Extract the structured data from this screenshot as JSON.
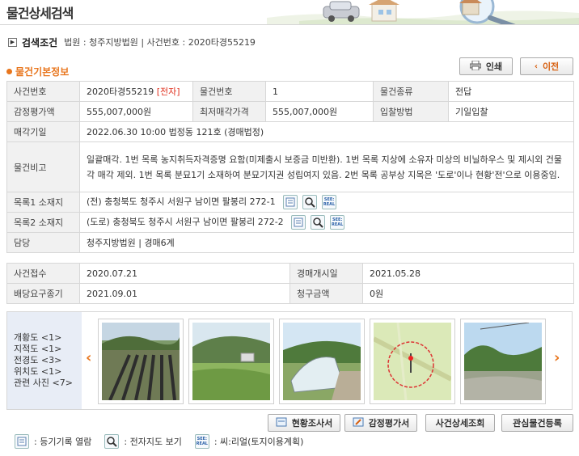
{
  "header": {
    "title": "물건상세검색"
  },
  "search_condition": {
    "title": "검색조건",
    "text": "법원 : 청주지방법원  |  사건번호 : 2020타경55219"
  },
  "section": {
    "title": "물건기본정보"
  },
  "actions": {
    "print": "인쇄",
    "back": "이전"
  },
  "basic": {
    "case_no_label": "사건번호",
    "case_no": "2020타경55219",
    "e_tag": "[전자]",
    "item_no_label": "물건번호",
    "item_no": "1",
    "item_type_label": "물건종류",
    "item_type": "전답",
    "appraisal_label": "감정평가액",
    "appraisal": "555,007,000원",
    "min_price_label": "최저매각가격",
    "min_price": "555,007,000원",
    "bid_method_label": "입찰방법",
    "bid_method": "기일입찰",
    "sale_date_label": "매각기일",
    "sale_date": "2022.06.30 10:00 법정동 121호 (경매법정)",
    "remark_label": "물건비고",
    "remark": "일괄매각. 1번 목록 농지취득자격증명 요함(미제출시 보증금 미반환). 1번 목록 지상에 소유자 미상의 비닐하우스 및 제시외 건물 각 매각 제외. 1번 목록 분묘1기 소재하여 분묘기지권 성립여지 있음. 2번 목록 공부상 지목은 '도로'이나 현황'전'으로 이용중임.",
    "loc1_label": "목록1 소재지",
    "loc1": "(전) 충청북도 청주시 서원구 남이면 팔봉리 272-1",
    "loc2_label": "목록2 소재지",
    "loc2": "(도로) 충청북도 청주시 서원구 남이면 팔봉리 272-2",
    "charge_label": "담당",
    "charge": "청주지방법원 | 경매6계"
  },
  "dates": {
    "received_label": "사건접수",
    "received": "2020.07.21",
    "start_label": "경매개시일",
    "start": "2021.05.28",
    "dividend_label": "배당요구종기",
    "dividend": "2021.09.01",
    "claim_label": "청구금액",
    "claim": "0원"
  },
  "photos": {
    "categories": [
      "개황도 <1>",
      "지적도 <1>",
      "전경도 <3>",
      "위치도 <1>",
      "관련 사진 <7>"
    ]
  },
  "bottom_buttons": {
    "survey": "현황조사서",
    "appraisal_doc": "감정평가서",
    "case_detail": "사건상세조회",
    "register": "관심물건등록"
  },
  "legend": {
    "registry": ": 등기기록 열람",
    "map": ": 전자지도 보기",
    "seereal": ": 씨:리얼(토지이용계획)",
    "seereal_icon_text": "SEE: REAL"
  },
  "colors": {
    "accent": "#e8761e",
    "red": "#e0301e",
    "header_cell": "#f1f1f1",
    "photo_panel": "#e8edf6"
  }
}
